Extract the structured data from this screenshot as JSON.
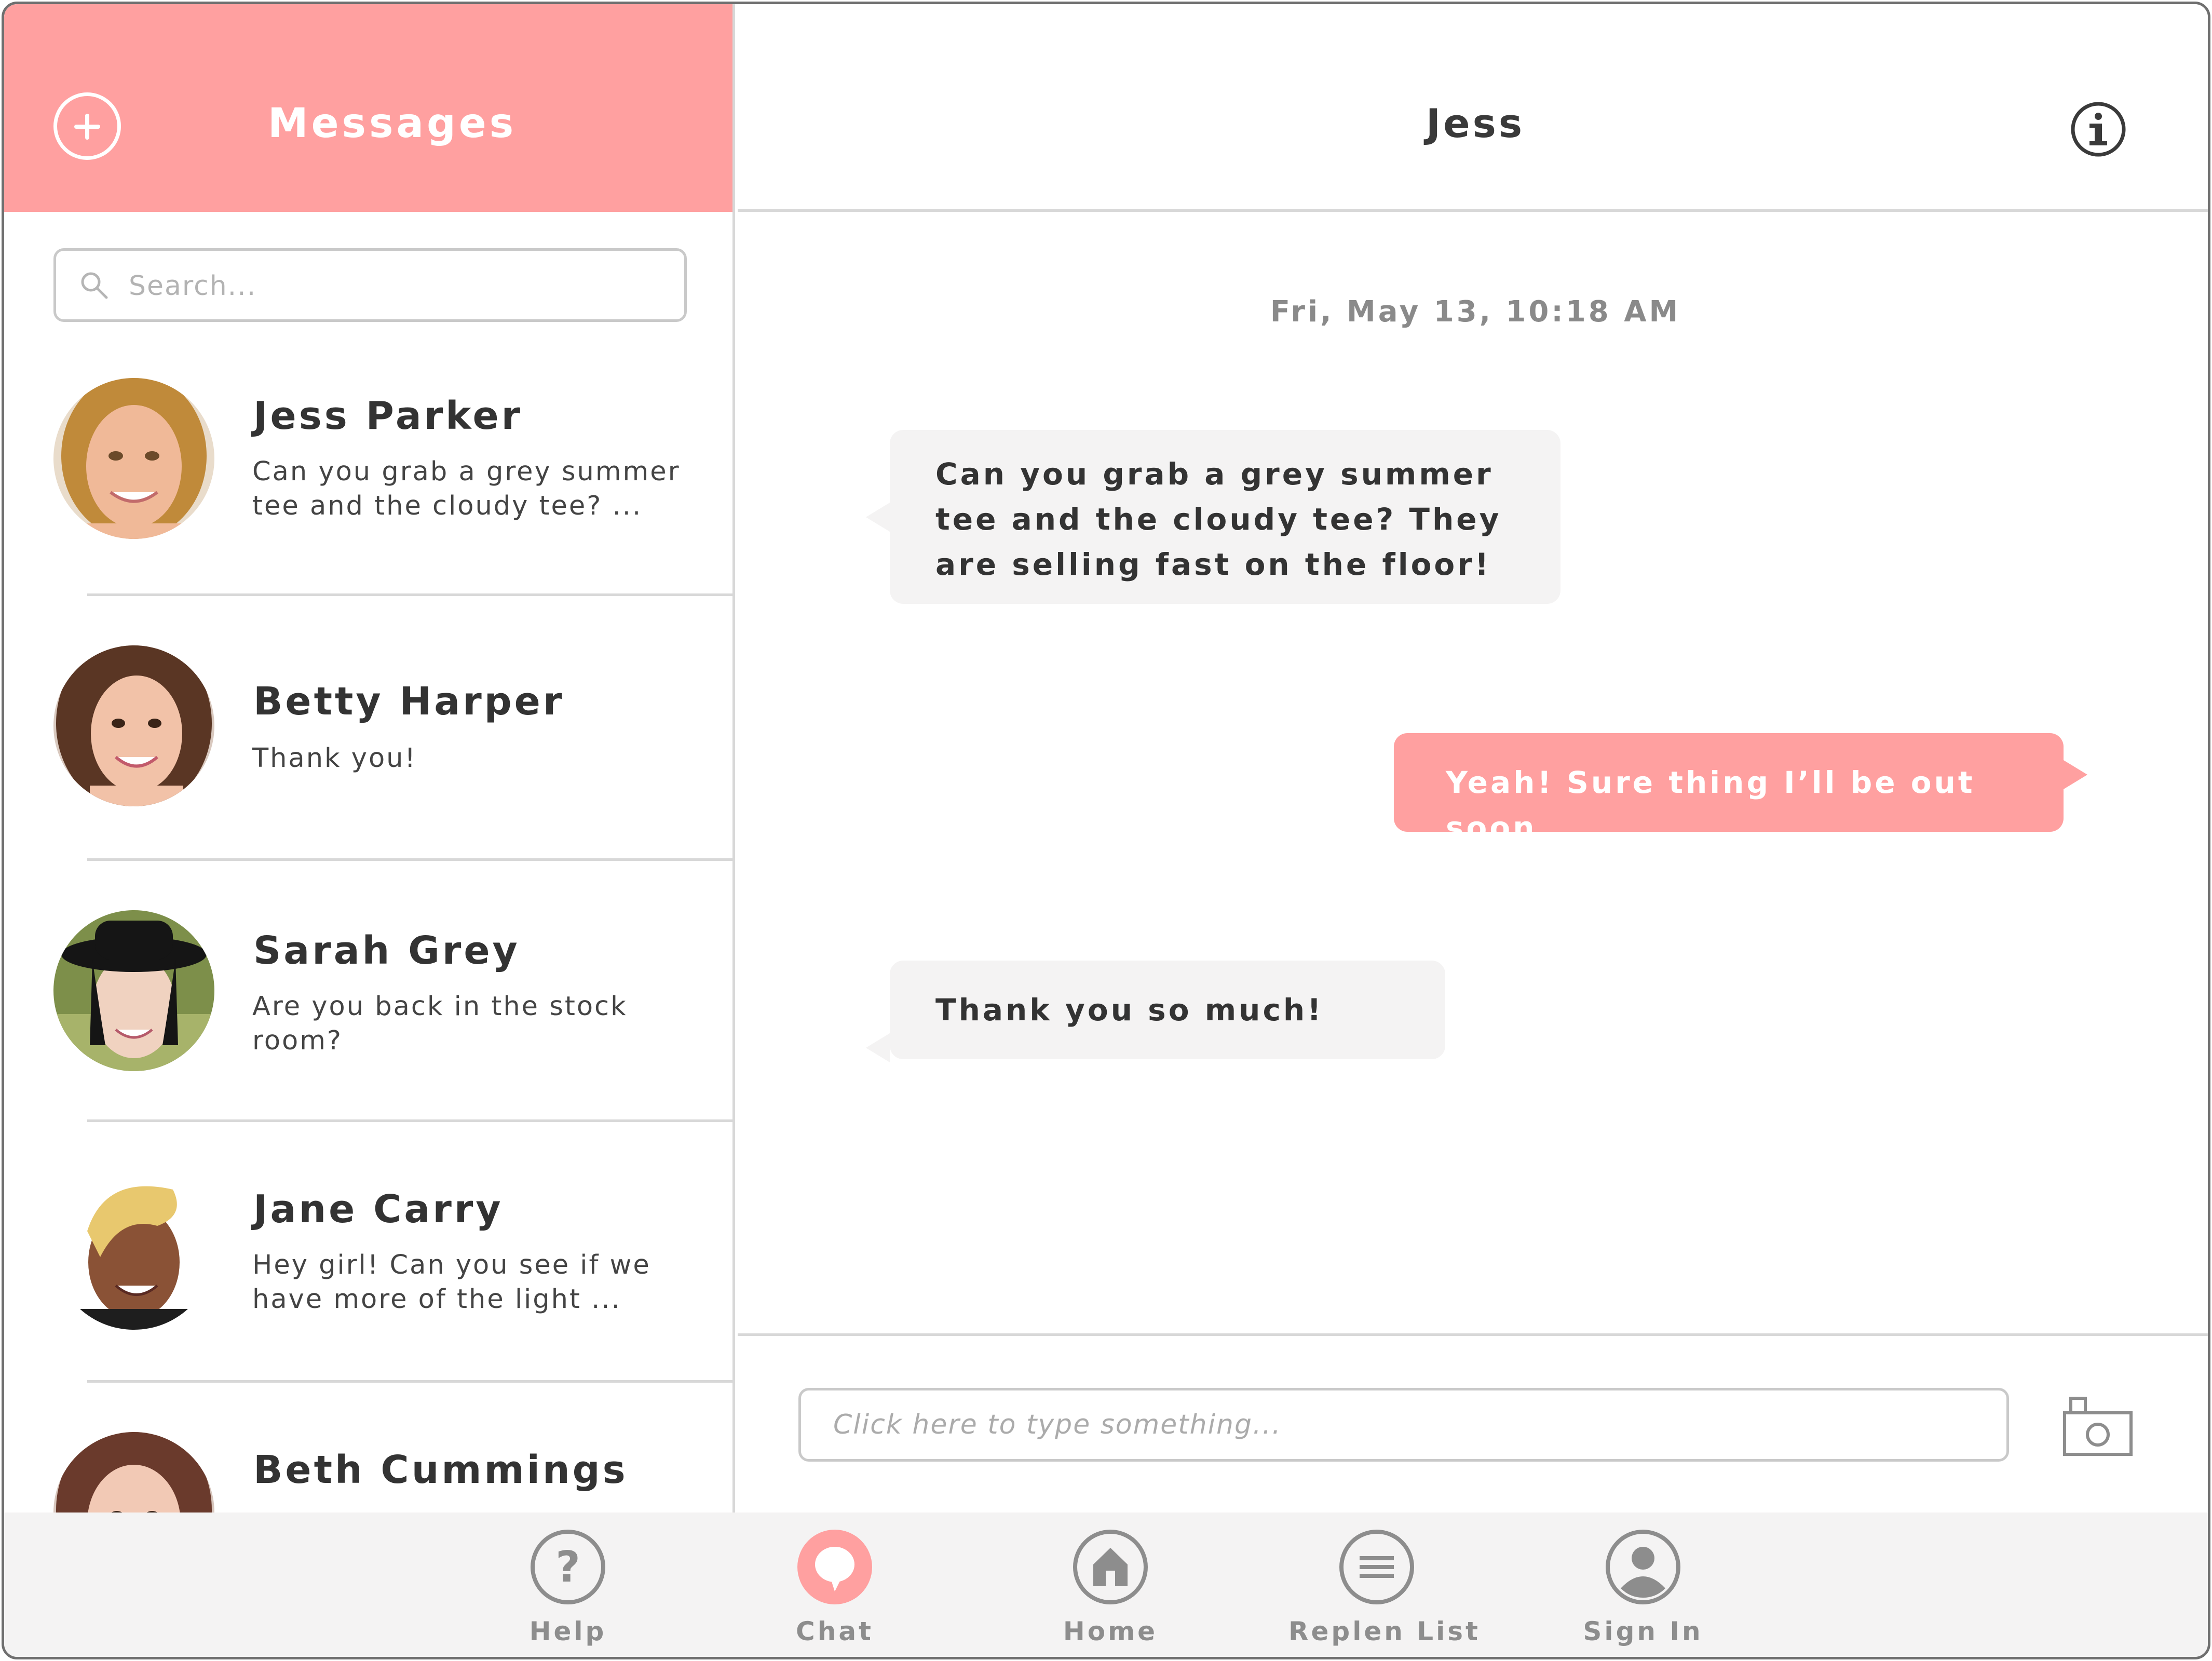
{
  "sidebar": {
    "title": "Messages",
    "search": {
      "placeholder": "Search..."
    },
    "conversations": [
      {
        "name": "Jess Parker",
        "preview": "Can you grab a grey summer tee and the cloudy tee? ..."
      },
      {
        "name": "Betty Harper",
        "preview": "Thank you!"
      },
      {
        "name": "Sarah Grey",
        "preview": "Are you back in the stock room?"
      },
      {
        "name": "Jane Carry",
        "preview": "Hey girl! Can you see if we have more of the light ..."
      },
      {
        "name": "Beth Cummings",
        "preview": ""
      }
    ]
  },
  "chat": {
    "title": "Jess",
    "timestamp": "Fri, May 13, 10:18 AM",
    "messages": [
      {
        "direction": "incoming",
        "text": "Can you grab a grey summer tee and the cloudy tee? They are selling fast on the floor!"
      },
      {
        "direction": "outgoing",
        "text": "Yeah! Sure thing I’ll be out soon."
      },
      {
        "direction": "incoming",
        "text": "Thank you so much!"
      }
    ],
    "composer": {
      "placeholder": "Click here to type something..."
    }
  },
  "tabbar": {
    "tabs": [
      {
        "label": "Help",
        "icon": "help-icon",
        "active": false
      },
      {
        "label": "Chat",
        "icon": "chat-icon",
        "active": true
      },
      {
        "label": "Home",
        "icon": "home-icon",
        "active": false
      },
      {
        "label": "Replen List",
        "icon": "list-icon",
        "active": false
      },
      {
        "label": "Sign In",
        "icon": "user-icon",
        "active": false
      }
    ]
  },
  "colors": {
    "accent": "#ffa0a0",
    "bubble_incoming": "#f4f3f3",
    "tabbar_bg": "#f4f3f3",
    "tab_inactive": "#8d8d8d",
    "divider": "#d8d8d8"
  }
}
